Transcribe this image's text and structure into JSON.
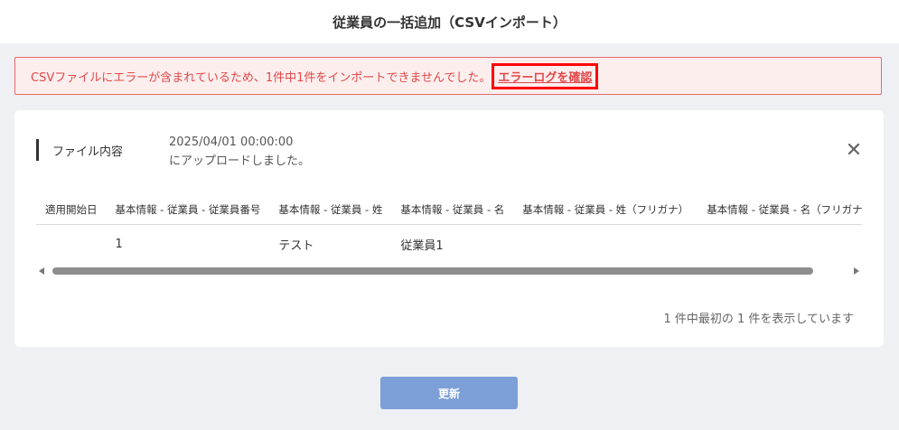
{
  "header": {
    "title": "従業員の一括追加（CSVインポート）"
  },
  "error_banner": {
    "message": "CSVファイルにエラーが含まれているため、1件中1件をインポートできませんでした。",
    "link_label": "エラーログを確認"
  },
  "file_panel": {
    "label": "ファイル内容",
    "uploaded_at": "2025/04/01 00:00:00",
    "uploaded_note": "にアップロードしました。",
    "close_label": "✕"
  },
  "table": {
    "headers": [
      "適用開始日",
      "基本情報 - 従業員 - 従業員番号",
      "基本情報 - 従業員 - 姓",
      "基本情報 - 従業員 - 名",
      "基本情報 - 従業員 - 姓（フリガナ）",
      "基本情報 - 従業員 - 名（フリガナ）"
    ],
    "rows": [
      [
        "",
        "1",
        "テスト",
        "従業員1",
        "",
        ""
      ]
    ]
  },
  "footer": {
    "record_count": "1 件中最初の 1 件を表示しています",
    "update_label": "更新"
  },
  "colors": {
    "error_text": "#e04848",
    "error_border": "#e46a6a",
    "error_bg": "#fdeeee",
    "highlight": "#ff0000",
    "button": "#7c9fd8"
  }
}
